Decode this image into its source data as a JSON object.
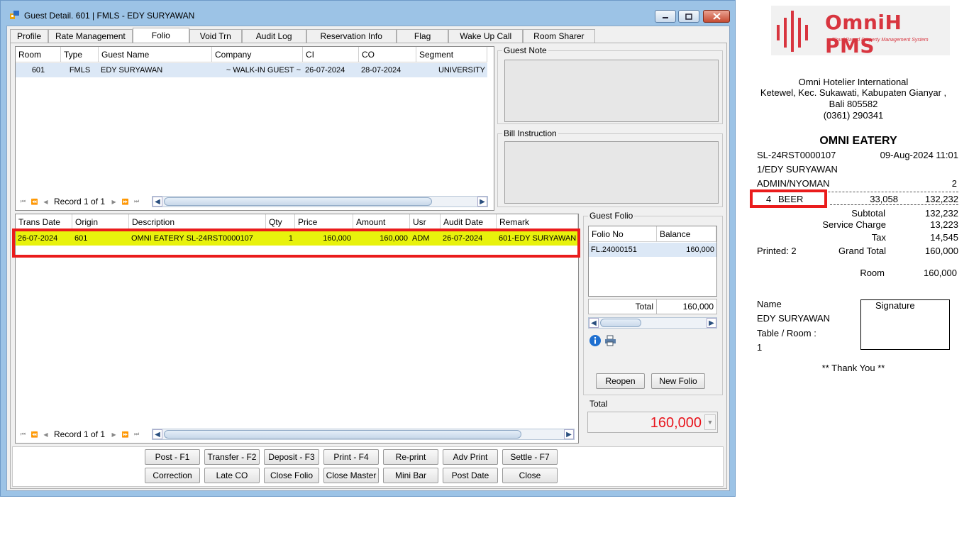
{
  "window": {
    "title": "Guest Detail. 601 | FMLS - EDY SURYAWAN"
  },
  "tabs": [
    "Profile",
    "Rate Management",
    "Folio",
    "Void Trn",
    "Audit Log",
    "Reservation Info",
    "Flag",
    "Wake Up Call",
    "Room Sharer"
  ],
  "active_tab": "Folio",
  "reservation_grid": {
    "columns": [
      "Room",
      "Type",
      "Guest Name",
      "Company",
      "CI",
      "CO",
      "Segment"
    ],
    "rows": [
      [
        "601",
        "FMLS",
        "EDY SURYAWAN",
        "~ WALK-IN GUEST ~",
        "26-07-2024",
        "28-07-2024",
        "UNIVERSITY"
      ]
    ],
    "record_text": "Record 1 of 1"
  },
  "guest_note": {
    "label": "Guest Note",
    "value": ""
  },
  "bill_instruction": {
    "label": "Bill Instruction",
    "value": ""
  },
  "transaction_grid": {
    "columns": [
      "Trans Date",
      "Origin",
      "Description",
      "Qty",
      "Price",
      "Amount",
      "Usr",
      "Audit Date",
      "Remark"
    ],
    "rows": [
      [
        "26-07-2024",
        "601",
        "OMNI EATERY SL-24RST0000107",
        "1",
        "160,000",
        "160,000",
        "ADM",
        "26-07-2024",
        "601-EDY SURYAWAN"
      ]
    ],
    "record_text": "Record 1 of 1",
    "highlight_color": "#e8f20c"
  },
  "guest_folio": {
    "label": "Guest Folio",
    "columns": [
      "Folio No",
      "Balance"
    ],
    "rows": [
      [
        "FL.24000151",
        "160,000"
      ]
    ],
    "total_label": "Total",
    "total_value": "160,000",
    "reopen_label": "Reopen",
    "new_folio_label": "New Folio",
    "icons": [
      "info-icon",
      "printer-icon"
    ]
  },
  "total": {
    "label": "Total",
    "value": "160,000",
    "color": "#e8141c"
  },
  "buttons_row1": [
    "Post - F1",
    "Transfer - F2",
    "Deposit - F3",
    "Print - F4",
    "Re-print",
    "Adv Print",
    "Settle - F7"
  ],
  "buttons_row2": [
    "Correction",
    "Late CO",
    "Close Folio",
    "Close Master",
    "Mini Bar",
    "Post Date",
    "Close"
  ],
  "receipt": {
    "logo_text": "OmniH PMS",
    "logo_tagline": "Cloud Based Property Management System",
    "logo_color": "#d8353f",
    "company": "Omni Hotelier International",
    "address1": "Ketewel, Kec. Sukawati, Kabupaten Gianyar ,",
    "address2": "Bali 805582",
    "phone": "(0361) 290341",
    "outlet": "OMNI EATERY",
    "bill_no": "SL-24RST0000107",
    "datetime": "09-Aug-2024  11:01",
    "guest": "1/EDY SURYAWAN",
    "cashier": "ADMIN/NYOMAN",
    "cashier_count": "2",
    "item_qty": "4",
    "item_name": "BEER",
    "item_price": "33,058",
    "item_amount": "132,232",
    "subtotal_label": "Subtotal",
    "subtotal": "132,232",
    "service_label": "Service Charge",
    "service": "13,223",
    "tax_label": "Tax",
    "tax": "14,545",
    "printed": "Printed: 2",
    "grand_label": "Grand Total",
    "grand": "160,000",
    "room_label": "Room",
    "room_amount": "160,000",
    "name_label": "Name",
    "name_value": "EDY SURYAWAN",
    "table_label": "Table / Room :",
    "table_value": "1",
    "signature_label": "Signature",
    "thanks": "** Thank You **"
  }
}
